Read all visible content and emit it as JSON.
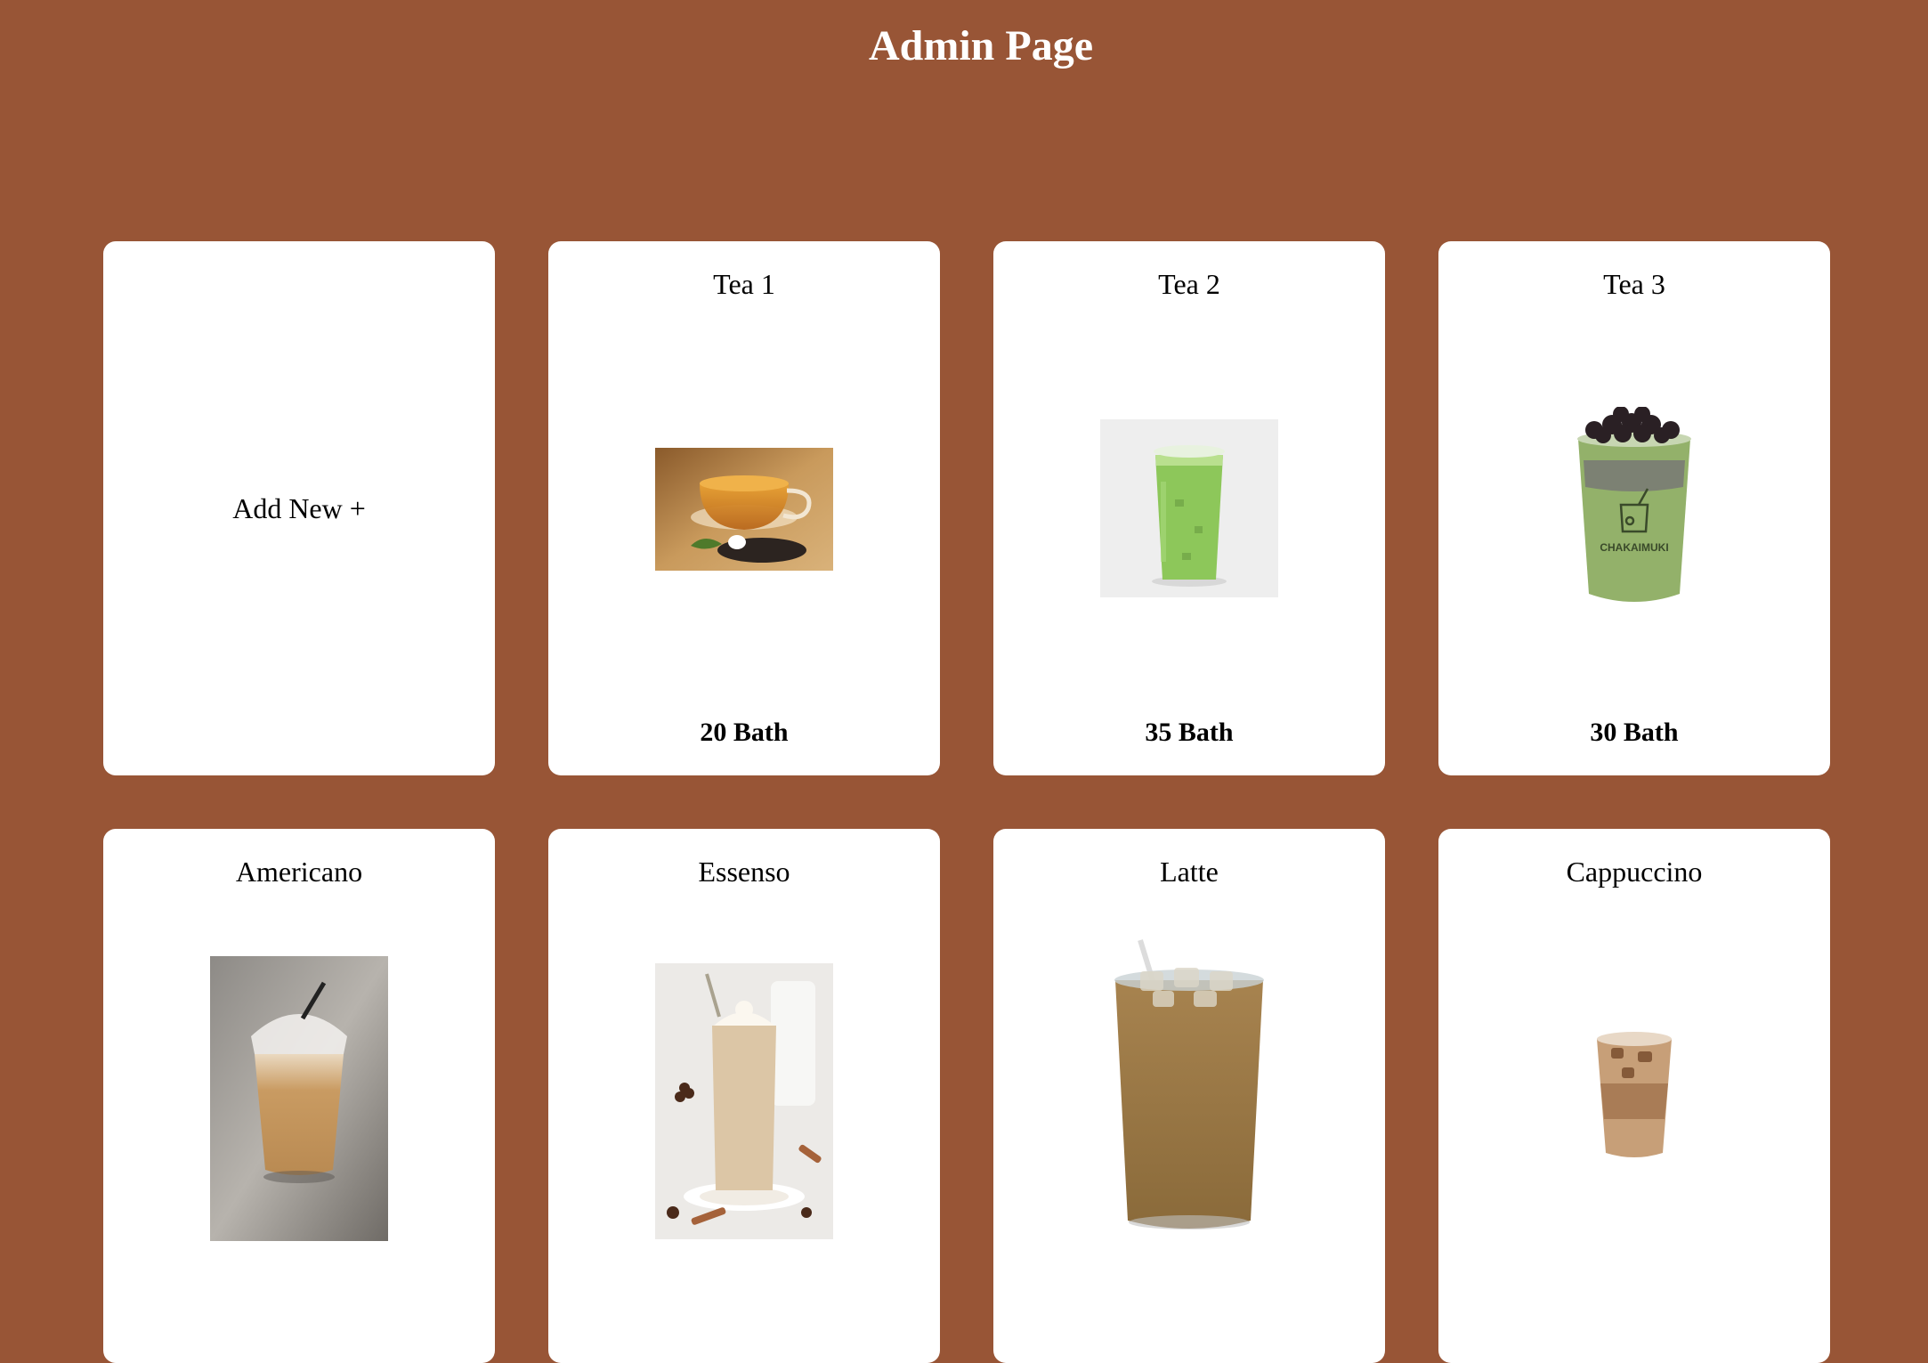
{
  "header": {
    "title": "Admin Page"
  },
  "colors": {
    "background": "#985536",
    "card": "#ffffff"
  },
  "add_card": {
    "label": "Add New +"
  },
  "products": [
    {
      "name": "Tea 1",
      "price": "20 Bath",
      "image": "hot-tea-cup-image"
    },
    {
      "name": "Tea 2",
      "price": "35 Bath",
      "image": "iced-matcha-latte-image"
    },
    {
      "name": "Tea 3",
      "price": "30 Bath",
      "image": "matcha-bubble-tea-image"
    },
    {
      "name": "Americano",
      "price": "",
      "image": "iced-americano-image"
    },
    {
      "name": "Essenso",
      "price": "",
      "image": "iced-milk-coffee-image"
    },
    {
      "name": "Latte",
      "price": "",
      "image": "iced-latte-image"
    },
    {
      "name": "Cappuccino",
      "price": "",
      "image": "iced-cappuccino-image"
    }
  ]
}
